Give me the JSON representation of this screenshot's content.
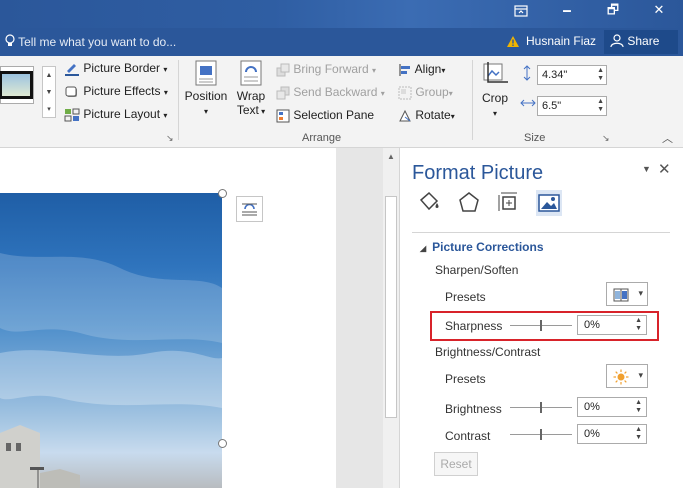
{
  "window": {
    "restore_icon": "restore-icon",
    "minimize_glyph": "🗕",
    "maximize_glyph": "🗗",
    "close_glyph": "✕"
  },
  "tellbar": {
    "tell_me": "Tell me what you want to do...",
    "user": "Husnain Fiaz",
    "share": "Share"
  },
  "ribbon": {
    "picture_styles": {
      "border": "Picture Border",
      "effects": "Picture Effects",
      "layout": "Picture Layout"
    },
    "arrange": {
      "position": "Position",
      "wrap_text_1": "Wrap",
      "wrap_text_2": "Text",
      "bring_forward": "Bring Forward",
      "send_backward": "Send Backward",
      "selection_pane": "Selection Pane",
      "align": "Align",
      "group": "Group",
      "rotate": "Rotate",
      "label": "Arrange"
    },
    "size": {
      "crop": "Crop",
      "height": "4.34\"",
      "width": "6.5\"",
      "label": "Size"
    }
  },
  "pane": {
    "title": "Format Picture",
    "section": "Picture Corrections",
    "sharpen_soften": "Sharpen/Soften",
    "presets": "Presets",
    "sharpness": "Sharpness",
    "sharpness_value": "0%",
    "brightness_contrast": "Brightness/Contrast",
    "presets2": "Presets",
    "brightness": "Brightness",
    "brightness_value": "0%",
    "contrast": "Contrast",
    "contrast_value": "0%",
    "reset": "Reset"
  },
  "colors": {
    "accent": "#2b579a",
    "highlight": "#d8232a"
  }
}
